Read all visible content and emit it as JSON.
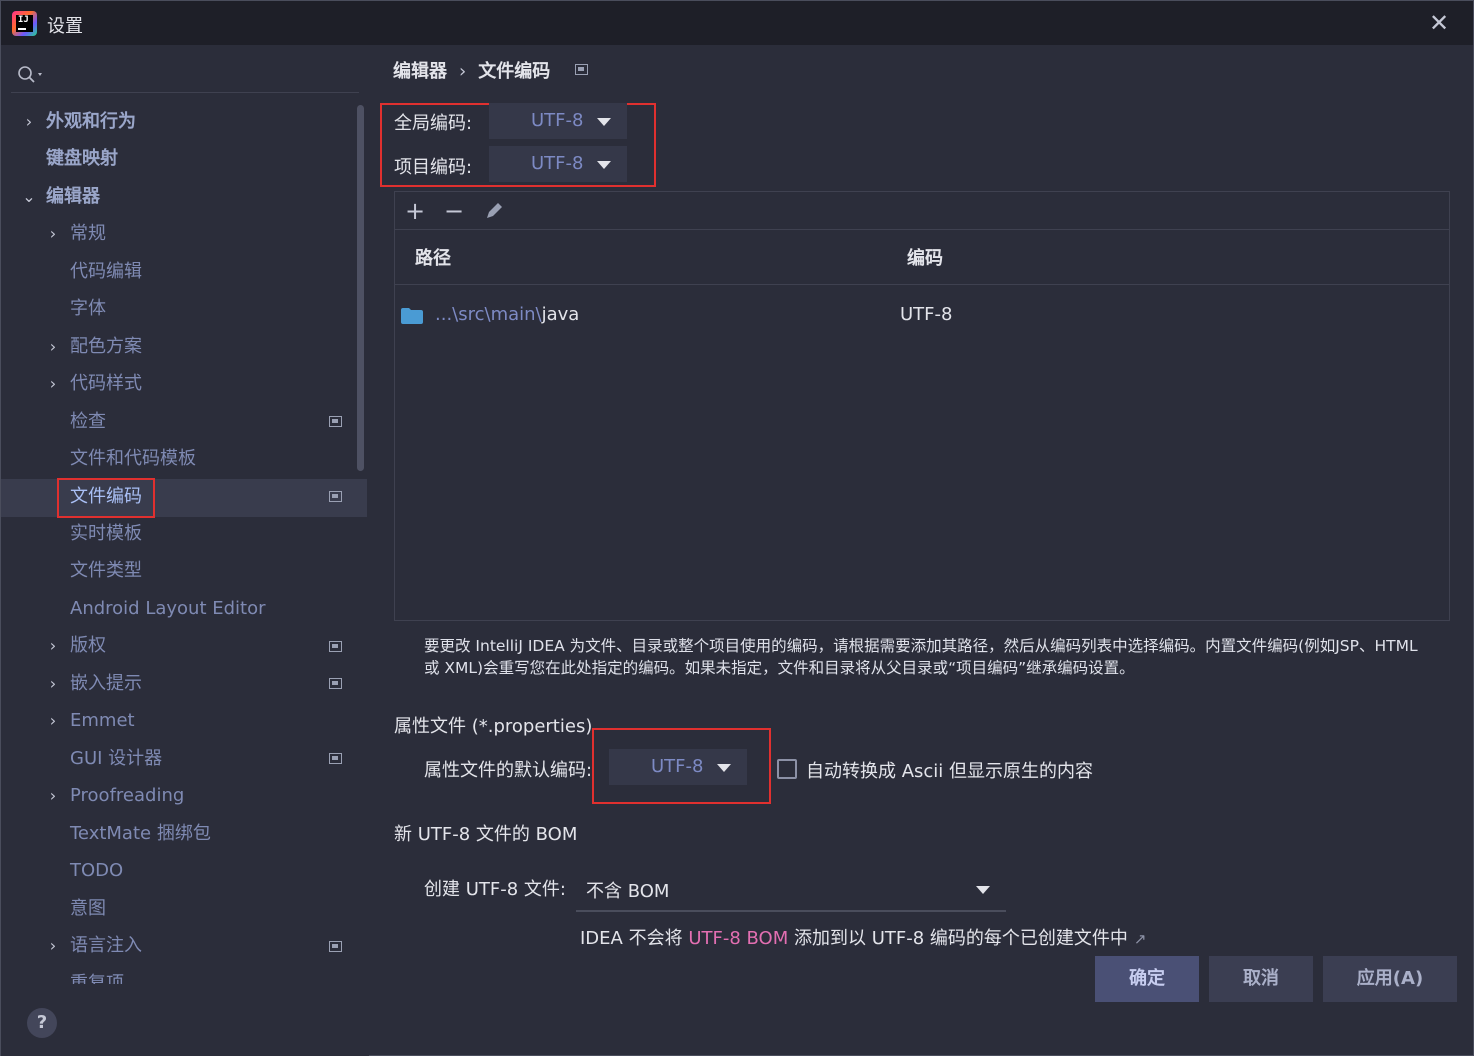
{
  "window": {
    "title": "设置",
    "close_icon": "close-icon",
    "app_icon_text": "IJ"
  },
  "sidebar": {
    "items": [
      {
        "label": "外观和行为",
        "expandable": true,
        "expanded": false,
        "level": 0
      },
      {
        "label": "键盘映射",
        "expandable": false,
        "level": 0
      },
      {
        "label": "编辑器",
        "expandable": true,
        "expanded": true,
        "level": 0
      },
      {
        "label": "常规",
        "expandable": true,
        "level": 1
      },
      {
        "label": "代码编辑",
        "level": 1
      },
      {
        "label": "字体",
        "level": 1
      },
      {
        "label": "配色方案",
        "expandable": true,
        "level": 1
      },
      {
        "label": "代码样式",
        "expandable": true,
        "level": 1
      },
      {
        "label": "检查",
        "level": 1,
        "project_icon": true
      },
      {
        "label": "文件和代码模板",
        "level": 1
      },
      {
        "label": "文件编码",
        "level": 1,
        "selected": true,
        "project_icon": true
      },
      {
        "label": "实时模板",
        "level": 1
      },
      {
        "label": "文件类型",
        "level": 1
      },
      {
        "label": "Android Layout Editor",
        "level": 1
      },
      {
        "label": "版权",
        "expandable": true,
        "level": 1,
        "project_icon": true
      },
      {
        "label": "嵌入提示",
        "expandable": true,
        "level": 1,
        "project_icon": true
      },
      {
        "label": "Emmet",
        "expandable": true,
        "level": 1
      },
      {
        "label": "GUI 设计器",
        "level": 1,
        "project_icon": true
      },
      {
        "label": "Proofreading",
        "expandable": true,
        "level": 1
      },
      {
        "label": "TextMate 捆绑包",
        "level": 1
      },
      {
        "label": "TODO",
        "level": 1
      },
      {
        "label": "意图",
        "level": 1
      },
      {
        "label": "语言注入",
        "expandable": true,
        "level": 1,
        "project_icon": true
      },
      {
        "label": "重复项",
        "level": 1
      }
    ]
  },
  "breadcrumb": {
    "parent": "编辑器",
    "current": "文件编码"
  },
  "global_encoding": {
    "label": "全局编码:",
    "value": "UTF-8"
  },
  "project_encoding": {
    "label": "项目编码:",
    "value": "UTF-8"
  },
  "table": {
    "col_path": "路径",
    "col_encoding": "编码",
    "rows": [
      {
        "path_prefix": "...\\src\\main\\",
        "path_tail": "java",
        "encoding": "UTF-8"
      }
    ]
  },
  "description": "要更改 IntelliJ IDEA 为文件、目录或整个项目使用的编码，请根据需要添加其路径，然后从编码列表中选择编码。内置文件编码(例如JSP、HTML 或 XML)会重写您在此处指定的编码。如果未指定，文件和目录将从父目录或“项目编码”继承编码设置。",
  "properties": {
    "section": "属性文件 (*.properties)",
    "default_label": "属性文件的默认编码:",
    "default_value": "UTF-8",
    "checkbox_label": "自动转换成 Ascii 但显示原生的内容",
    "checked": false
  },
  "bom": {
    "section": "新 UTF-8 文件的 BOM",
    "create_label": "创建 UTF-8 文件:",
    "create_value": "不含 BOM",
    "note_prefix": "IDEA 不会将 ",
    "note_link": "UTF-8 BOM",
    "note_suffix": " 添加到以 UTF-8 编码的每个已创建文件中"
  },
  "buttons": {
    "ok": "确定",
    "cancel": "取消",
    "apply": "应用(A)"
  },
  "help": "?"
}
